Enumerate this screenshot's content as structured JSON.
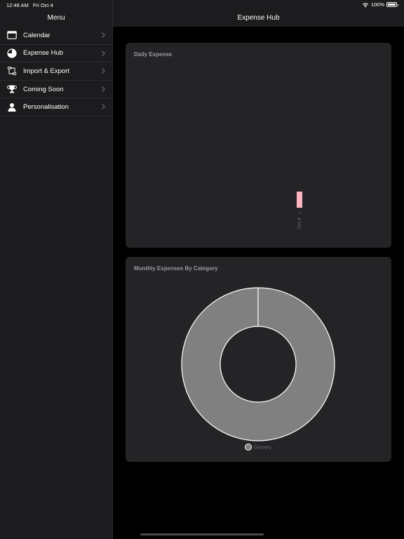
{
  "status_bar": {
    "time": "12:48 AM",
    "date": "Fri Oct 4",
    "battery": "100%"
  },
  "sidebar": {
    "title": "Menu",
    "items": [
      {
        "label": "Calendar",
        "icon": "calendar-icon"
      },
      {
        "label": "Expense Hub",
        "icon": "pie-icon"
      },
      {
        "label": "Import & Export",
        "icon": "import-export-icon"
      },
      {
        "label": "Coming Soon",
        "icon": "trophy-icon"
      },
      {
        "label": "Personalisation",
        "icon": "person-icon"
      }
    ]
  },
  "main": {
    "title": "Expense Hub"
  },
  "daily_card": {
    "title": "Daily Expense"
  },
  "monthly_card": {
    "title": "Monthly Expenses By Category"
  },
  "colors": {
    "bar": "#ffb6c1",
    "donut": "#808080"
  },
  "chart_data": [
    {
      "type": "bar",
      "title": "Daily Expense",
      "categories": [
        "Oct 4"
      ],
      "values": [
        1
      ],
      "ylim": [
        0,
        10
      ],
      "grid": false
    },
    {
      "type": "pie",
      "title": "Monthly Expenses By Category",
      "labels": [
        "Grocery"
      ],
      "values": [
        100
      ],
      "legend": "bottom"
    }
  ]
}
